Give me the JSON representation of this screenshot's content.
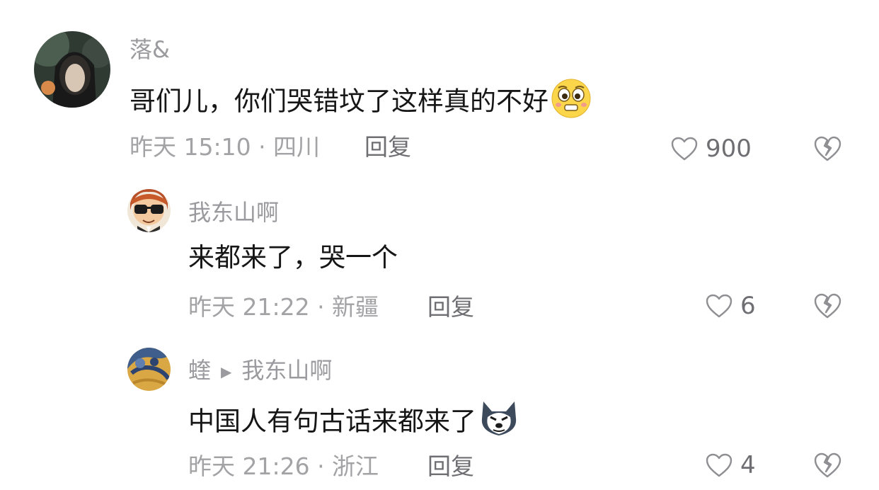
{
  "comments": [
    {
      "username": "落&",
      "text": "哥们儿，你们哭错坟了这样真的不好",
      "emoji": "pleading-face-emoji",
      "meta": "昨天 15:10 · 四川",
      "reply_label": "回复",
      "likes": "900"
    },
    {
      "username": "我东山啊",
      "text": "来都来了，哭一个",
      "meta": "昨天 21:22 · 新疆",
      "reply_label": "回复",
      "likes": "6"
    },
    {
      "username": "蝰",
      "reply_to": "我东山啊",
      "text": "中国人有句古话来都来了",
      "emoji": "husky-dog-emoji",
      "meta": "昨天 21:26 · 浙江",
      "reply_label": "回复",
      "likes": "4"
    }
  ],
  "colors": {
    "username": "#9b9b9f",
    "content": "#161616",
    "meta": "#a3a3a6",
    "action": "#6e6e73"
  }
}
